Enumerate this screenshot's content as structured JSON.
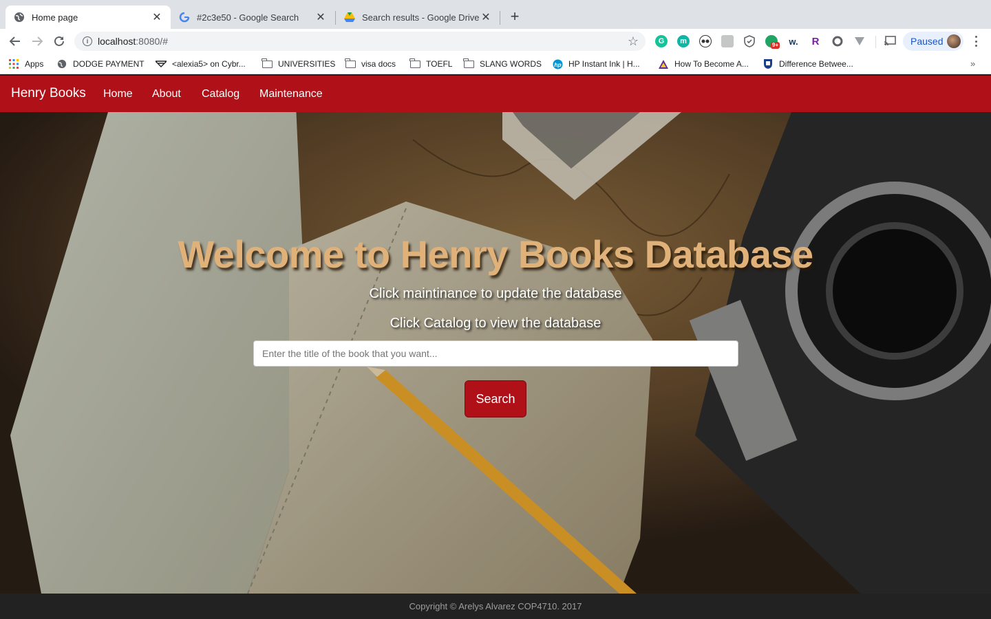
{
  "browser": {
    "tabs": [
      {
        "title": "Home page",
        "active": true,
        "icon": "globe-icon"
      },
      {
        "title": "#2c3e50 - Google Search",
        "active": false,
        "icon": "google-icon"
      },
      {
        "title": "Search results - Google Drive",
        "active": false,
        "icon": "google-drive-icon"
      }
    ],
    "address": {
      "host": "localhost",
      "rest": ":8080/#"
    },
    "profile": {
      "status": "Paused"
    },
    "extensions": [
      {
        "icon": "grammarly-icon",
        "label": "G",
        "color": "#15c39a"
      },
      {
        "icon": "mercury-icon",
        "label": "m",
        "color": "#10b5a3"
      },
      {
        "icon": "panda-icon",
        "label": "",
        "color": "#333333"
      },
      {
        "icon": "extension-icon",
        "label": "",
        "color": "#9aa0a6"
      },
      {
        "icon": "shield-icon",
        "label": "",
        "color": "#5f6368"
      },
      {
        "icon": "messenger-icon",
        "label": "",
        "color": "#1fa463",
        "badge": "9+"
      },
      {
        "icon": "wordtune-icon",
        "label": "w.",
        "color": "#1d3557"
      },
      {
        "icon": "r-icon",
        "label": "R",
        "color": "#7b1fa2"
      },
      {
        "icon": "circle-icon",
        "label": "",
        "color": "#5f6368"
      },
      {
        "icon": "vee-icon",
        "label": "",
        "color": "#5f6368"
      }
    ],
    "bookmarks": [
      {
        "label": "Apps",
        "icon": "apps-grid-icon"
      },
      {
        "label": "DODGE PAYMENT",
        "icon": "globe-icon"
      },
      {
        "label": "<alexia5> on Cybr...",
        "icon": "cyber-icon"
      },
      {
        "label": "UNIVERSITIES",
        "icon": "folder-icon"
      },
      {
        "label": "visa docs",
        "icon": "folder-icon"
      },
      {
        "label": "TOEFL",
        "icon": "folder-icon"
      },
      {
        "label": "SLANG WORDS",
        "icon": "folder-icon"
      },
      {
        "label": "HP Instant Ink | H...",
        "icon": "hp-icon"
      },
      {
        "label": "How To Become A...",
        "icon": "triangle-logo-icon"
      },
      {
        "label": "Difference Betwee...",
        "icon": "crest-icon"
      }
    ]
  },
  "site": {
    "brand": "Henry Books",
    "nav": [
      "Home",
      "About",
      "Catalog",
      "Maintenance"
    ],
    "hero": {
      "title": "Welcome to Henry Books Database",
      "line1": "Click maintinance to update the database",
      "line2": "Click Catalog to view the database",
      "search_placeholder": "Enter the title of the book that you want...",
      "search_button": "Search"
    },
    "footer": "Copyright © Arelys Alvarez COP4710. 2017",
    "colors": {
      "brand_red": "#b01018",
      "title_gold": "#e0b27a",
      "footer_bg": "#222222"
    }
  }
}
